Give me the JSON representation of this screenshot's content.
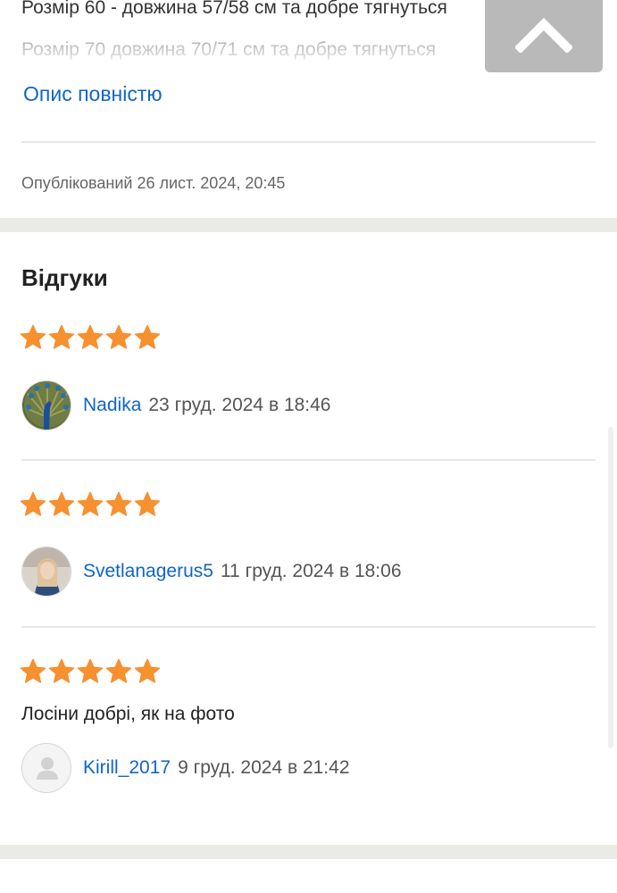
{
  "description": {
    "line1": "Розмір 60 - довжина 57/58 см та добре тягнуться",
    "line2": "Розмір 70 довжина 70/71 см та добре тягнуться",
    "more_link": "Опис повністю",
    "published": "Опублікований 26 лист. 2024, 20:45"
  },
  "scroll_top_icon": "chevron-up-icon",
  "reviews": {
    "title": "Відгуки",
    "star_color": "#f7902f",
    "items": [
      {
        "rating": 5,
        "author": "Nadika",
        "date": "23 груд. 2024 в 18:46",
        "text": "",
        "avatar": "peacock-photo"
      },
      {
        "rating": 5,
        "author": "Svetlanagerus5",
        "date": "11 груд. 2024 в 18:06",
        "text": "",
        "avatar": "woman-photo"
      },
      {
        "rating": 5,
        "author": "Kirill_2017",
        "date": "9 груд. 2024 в 21:42",
        "text": "Лосіни добрі, як на фото",
        "avatar": "default-user-icon"
      }
    ]
  },
  "colors": {
    "link": "#0f66c6",
    "band": "#ebebe6",
    "scroll_button": "#b9b9b9"
  }
}
